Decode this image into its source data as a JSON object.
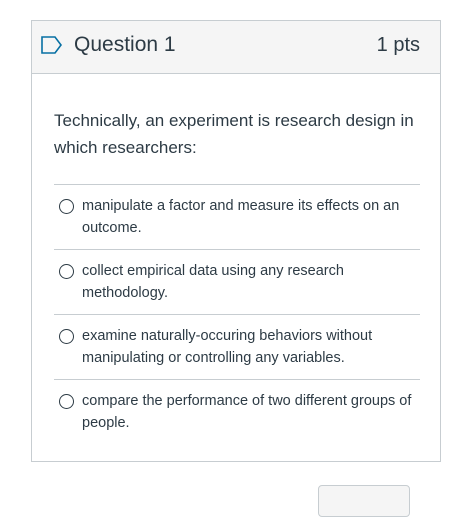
{
  "question": {
    "title": "Question 1",
    "points": "1 pts",
    "text": "Technically, an experiment is research design in which researchers:",
    "answers": [
      {
        "label": "manipulate a factor and measure its effects on an outcome."
      },
      {
        "label": "collect empirical data using any research methodology."
      },
      {
        "label": "examine naturally-occuring behaviors without manipulating or controlling any variables."
      },
      {
        "label": "compare the performance of two different groups of people."
      }
    ]
  },
  "colors": {
    "text": "#2d3b45",
    "border": "#c7cdd1",
    "header_bg": "#f5f5f5",
    "flag": "#0770a3"
  }
}
